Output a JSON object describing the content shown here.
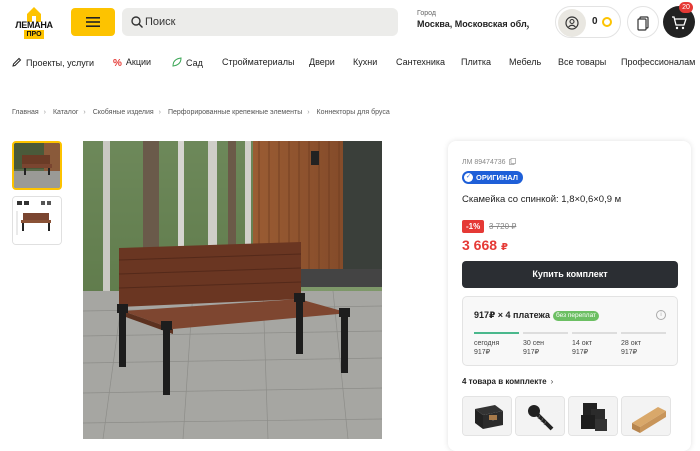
{
  "header": {
    "logo_text": "ЛЕМАНА",
    "logo_sub": "ПРО",
    "search_placeholder": "Поиск",
    "city_label": "Город",
    "city_value": "Москва, Московская обл.",
    "bonus_count": "0",
    "cart_badge": "20",
    "brand_color": "#fdc300"
  },
  "nav": {
    "items": [
      {
        "label": "Проекты, услуги",
        "icon": "pencil-icon"
      },
      {
        "label": "Акции",
        "icon": "percent-icon"
      },
      {
        "label": "Сад",
        "icon": "leaf-icon"
      },
      {
        "label": "Стройматериалы"
      },
      {
        "label": "Двери"
      },
      {
        "label": "Кухни"
      },
      {
        "label": "Сантехника"
      },
      {
        "label": "Плитка"
      },
      {
        "label": "Мебель"
      },
      {
        "label": "Все товары"
      },
      {
        "label": "Профессионалам"
      }
    ]
  },
  "breadcrumbs": [
    "Главная",
    "Каталог",
    "Скобяные изделия",
    "Перфорированные крепежные элементы",
    "Коннекторы для бруса"
  ],
  "product": {
    "sku": "ЛМ 89474736",
    "original_badge": "ОРИГИНАЛ",
    "title": "Скамейка со спинкой: 1,8×0,6×0,9 м",
    "discount": "-1%",
    "old_price": "3 720 ₽",
    "new_price": "3 668",
    "currency": "₽",
    "buy_label": "Купить комплект",
    "installments": {
      "title": "917₽ × 4 платежа",
      "badge": "без переплат",
      "paid_fraction": 0.25,
      "payments": [
        {
          "date": "сегодня",
          "amount": "917₽"
        },
        {
          "date": "30 сен",
          "amount": "917₽"
        },
        {
          "date": "14 окт",
          "amount": "917₽"
        },
        {
          "date": "28 окт",
          "amount": "917₽"
        }
      ]
    },
    "kit_label": "4 товара в комплекте",
    "kit_items": [
      "connector-icon",
      "screw-icon",
      "corner-bracket-icon",
      "timber-icon"
    ]
  }
}
